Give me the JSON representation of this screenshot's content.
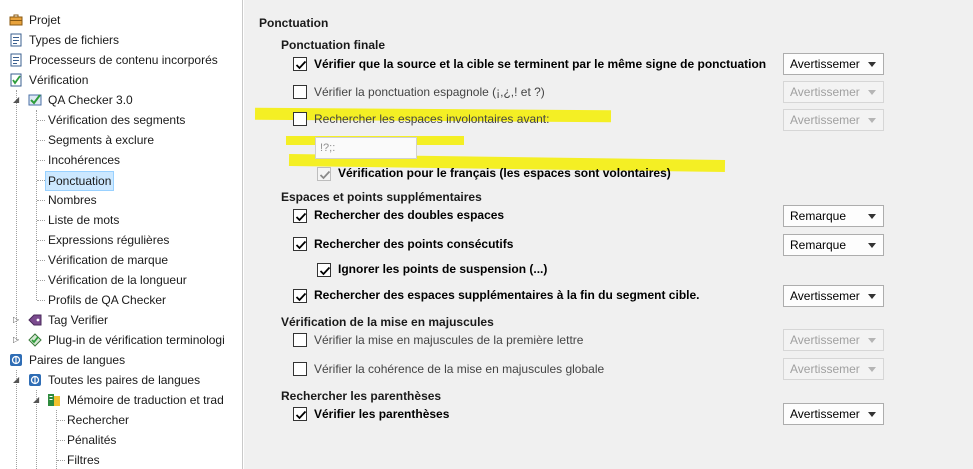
{
  "tree": {
    "items": [
      {
        "label": "Projet",
        "icon": "briefcase-icon"
      },
      {
        "label": "Types de fichiers",
        "icon": "file-types-icon"
      },
      {
        "label": "Processeurs de contenu incorporés",
        "icon": "file-types-icon"
      },
      {
        "label": "Vérification",
        "icon": "verification-icon"
      },
      {
        "label": "QA Checker 3.0",
        "icon": "qa-checker-icon"
      },
      {
        "label": "Vérification des segments"
      },
      {
        "label": "Segments à exclure"
      },
      {
        "label": "Incohérences"
      },
      {
        "label": "Ponctuation"
      },
      {
        "label": "Nombres"
      },
      {
        "label": "Liste de mots"
      },
      {
        "label": "Expressions régulières"
      },
      {
        "label": "Vérification de marque"
      },
      {
        "label": "Vérification de la longueur"
      },
      {
        "label": "Profils de QA Checker"
      },
      {
        "label": "Tag Verifier",
        "icon": "tag-icon"
      },
      {
        "label": "Plug-in de vérification terminologi",
        "icon": "term-check-icon"
      },
      {
        "label": "Paires de langues",
        "icon": "language-pairs-icon"
      },
      {
        "label": "Toutes les paires de langues",
        "icon": "language-pairs-icon"
      },
      {
        "label": "Mémoire de traduction et trad",
        "icon": "tm-icon"
      },
      {
        "label": "Rechercher"
      },
      {
        "label": "Pénalités"
      },
      {
        "label": "Filtres"
      }
    ]
  },
  "panel": {
    "title": "Ponctuation",
    "sections": {
      "finale": {
        "heading": "Ponctuation finale",
        "opt1": {
          "label": "Vérifier que la source et la cible se terminent par le même signe de ponctuation",
          "combo": "Avertissemer"
        },
        "opt2": {
          "label": "Vérifier la ponctuation espagnole (¡,¿,! et ?)",
          "combo": "Avertissemer"
        },
        "opt3": {
          "label": "Rechercher les espaces involontaires avant:",
          "combo": "Avertissemer"
        },
        "chars": "!?;:",
        "opt4": {
          "label": "Vérification pour le français (les espaces sont volontaires)"
        }
      },
      "espaces": {
        "heading": "Espaces et points supplémentaires",
        "opt1": {
          "label": "Rechercher des doubles espaces",
          "combo": "Remarque"
        },
        "opt2": {
          "label": "Rechercher des points consécutifs",
          "combo": "Remarque"
        },
        "opt3": {
          "label": "Ignorer les points de suspension (...)"
        },
        "opt4": {
          "label": "Rechercher des espaces supplémentaires à la fin du segment cible.",
          "combo": "Avertissemer"
        }
      },
      "majuscules": {
        "heading": "Vérification de la mise en majuscules",
        "opt1": {
          "label": "Vérifier la mise en majuscules de la première lettre",
          "combo": "Avertissemer"
        },
        "opt2": {
          "label": "Vérifier la cohérence de la mise en majuscules globale",
          "combo": "Avertissemer"
        }
      },
      "parentheses": {
        "heading": "Rechercher les parenthèses",
        "opt1": {
          "label": "Vérifier les parenthèses",
          "combo": "Avertissemer"
        }
      }
    }
  },
  "colors": {
    "highlight": "#f5ef00",
    "selection": "#cce8ff",
    "panel_bg": "#f0f0f0"
  }
}
